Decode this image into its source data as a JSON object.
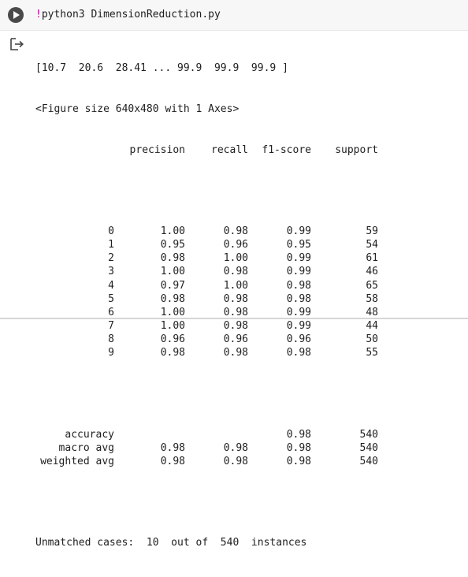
{
  "cell": {
    "command_prefix": "!",
    "command": "python3 DimensionReduction.py",
    "run_icon": "play-icon",
    "output_icon": "output-redirect-icon"
  },
  "output": {
    "array_line": "[10.7  20.6  28.41 ... 99.9  99.9  99.9 ]",
    "figure_line": "<Figure size 640x480 with 1 Axes>",
    "headers": [
      "precision",
      "recall",
      "f1-score",
      "support"
    ],
    "class_rows": [
      {
        "label": "0",
        "precision": "1.00",
        "recall": "0.98",
        "f1": "0.99",
        "support": "59"
      },
      {
        "label": "1",
        "precision": "0.95",
        "recall": "0.96",
        "f1": "0.95",
        "support": "54"
      },
      {
        "label": "2",
        "precision": "0.98",
        "recall": "1.00",
        "f1": "0.99",
        "support": "61"
      },
      {
        "label": "3",
        "precision": "1.00",
        "recall": "0.98",
        "f1": "0.99",
        "support": "46"
      },
      {
        "label": "4",
        "precision": "0.97",
        "recall": "1.00",
        "f1": "0.98",
        "support": "65"
      },
      {
        "label": "5",
        "precision": "0.98",
        "recall": "0.98",
        "f1": "0.98",
        "support": "58"
      },
      {
        "label": "6",
        "precision": "1.00",
        "recall": "0.98",
        "f1": "0.99",
        "support": "48"
      },
      {
        "label": "7",
        "precision": "1.00",
        "recall": "0.98",
        "f1": "0.99",
        "support": "44"
      },
      {
        "label": "8",
        "precision": "0.96",
        "recall": "0.96",
        "f1": "0.96",
        "support": "50"
      },
      {
        "label": "9",
        "precision": "0.98",
        "recall": "0.98",
        "f1": "0.98",
        "support": "55"
      }
    ],
    "summary_rows": [
      {
        "label": "accuracy",
        "precision": "",
        "recall": "",
        "f1": "0.98",
        "support": "540"
      },
      {
        "label": "macro avg",
        "precision": "0.98",
        "recall": "0.98",
        "f1": "0.98",
        "support": "540"
      },
      {
        "label": "weighted avg",
        "precision": "0.98",
        "recall": "0.98",
        "f1": "0.98",
        "support": "540"
      }
    ],
    "unmatched_line": "Unmatched cases:  10  out of  540  instances"
  }
}
